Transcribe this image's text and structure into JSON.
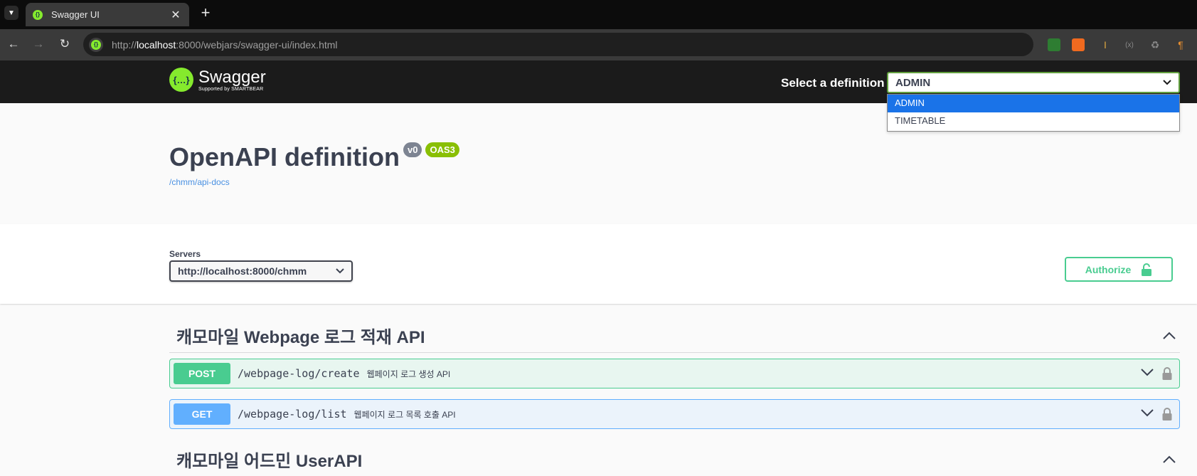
{
  "browser": {
    "tab_title": "Swagger UI",
    "url_host": "localhost",
    "url_scheme": "http://",
    "url_rest": ":8000/webjars/swagger-ui/index.html",
    "icons": [
      "tab-list-icon",
      "close-icon",
      "plus-icon",
      "back-icon",
      "forward-icon",
      "reload-icon",
      "site-info-icon",
      "extension-icons"
    ]
  },
  "topbar": {
    "logo_name": "Swagger",
    "logo_sub": "Supported by SMARTBEAR",
    "select_label": "Select a definition",
    "selected_definition": "ADMIN",
    "definitions": [
      "ADMIN",
      "TIMETABLE"
    ]
  },
  "info": {
    "title": "OpenAPI definition",
    "version": "v0",
    "oas": "OAS3",
    "url": "/chmm/api-docs"
  },
  "servers": {
    "label": "Servers",
    "selected": "http://localhost:8000/chmm",
    "authorize_label": "Authorize"
  },
  "tags": [
    {
      "name": "캐모마일 Webpage 로그 적재 API",
      "operations": [
        {
          "method": "POST",
          "path": "/webpage-log/create",
          "summary": "웹페이지 로그 생성 API"
        },
        {
          "method": "GET",
          "path": "/webpage-log/list",
          "summary": "웹페이지 로그 목록 호출 API"
        }
      ]
    },
    {
      "name": "캐모마일 어드민 UserAPI",
      "operations": []
    }
  ],
  "colors": {
    "post": "#49cc90",
    "get": "#61affe",
    "swagger_green": "#85ea2d",
    "select_border": "#62a03f",
    "dropdown_highlight": "#1a73e8"
  }
}
